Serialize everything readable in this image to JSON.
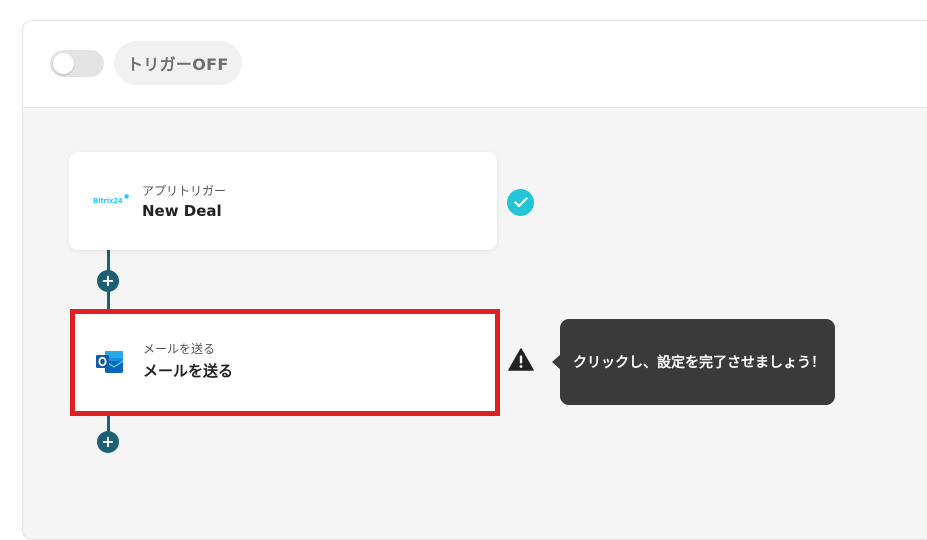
{
  "header": {
    "trigger_toggle_state": "off",
    "trigger_label": "トリガーOFF"
  },
  "flow": {
    "steps": [
      {
        "subtitle": "アプリトリガー",
        "title": "New Deal",
        "app_icon": "bitrix24-logo",
        "logo_text": "Bitrix24",
        "status": "complete"
      },
      {
        "subtitle": "メールを送る",
        "title": "メールを送る",
        "app_icon": "outlook-icon",
        "status": "warning"
      }
    ],
    "add_step_icon_label": "+"
  },
  "tooltip": {
    "text": "クリックし、設定を完了させましょう！"
  },
  "colors": {
    "connector": "#1e5f74",
    "check": "#23c4d8",
    "highlight": "#e02020",
    "tooltip_bg": "#3a3a3a"
  }
}
